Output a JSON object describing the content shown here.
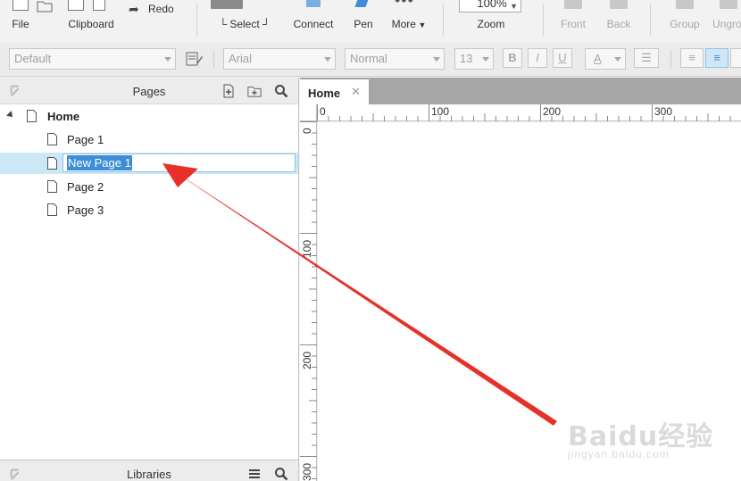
{
  "toolbar": {
    "file": "File",
    "clipboard": "Clipboard",
    "redo": "Redo",
    "select": "Select",
    "connect": "Connect",
    "pen": "Pen",
    "more": "More",
    "zoom_value": "100%",
    "zoom": "Zoom",
    "front": "Front",
    "back": "Back",
    "group": "Group",
    "ungroup": "Ungro"
  },
  "format": {
    "style": "Default",
    "font": "Arial",
    "weight": "Normal",
    "size": "13",
    "bold": "B",
    "italic": "I",
    "underline": "U",
    "font_color": "A"
  },
  "pages_panel": {
    "title": "Pages",
    "tree": [
      {
        "label": "Home"
      },
      {
        "label": "Page 1"
      },
      {
        "label": "New Page 1"
      },
      {
        "label": "Page 2"
      },
      {
        "label": "Page 3"
      }
    ]
  },
  "libraries_panel": {
    "title": "Libraries"
  },
  "tab": {
    "label": "Home",
    "close": "✕"
  },
  "ruler": {
    "h_labels": [
      "0",
      "100",
      "200",
      "300"
    ],
    "v_labels": [
      "0",
      "100",
      "200",
      "300"
    ]
  },
  "watermark": {
    "main": "Baidu经验",
    "sub": "jingyan.baidu.com"
  },
  "colors": {
    "accent": "#3d8ed6",
    "selected_row": "#cce8f6",
    "annotation_arrow": "#e8302a"
  }
}
